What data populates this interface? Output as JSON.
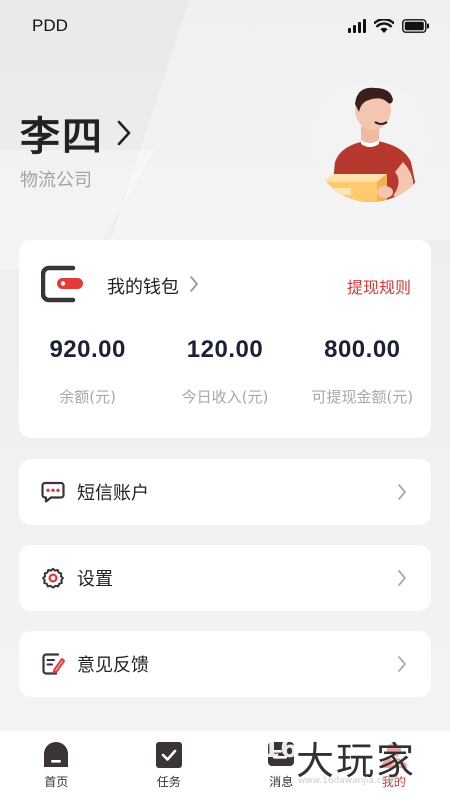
{
  "status_bar": {
    "carrier": "PDD"
  },
  "profile": {
    "name": "李四",
    "company": "物流公司"
  },
  "wallet": {
    "title": "我的钱包",
    "rule_link": "提现规则",
    "stats": [
      {
        "value": "920.00",
        "label": "余额(元)"
      },
      {
        "value": "120.00",
        "label": "今日收入(元)"
      },
      {
        "value": "800.00",
        "label": "可提现金额(元)"
      }
    ]
  },
  "menu": [
    {
      "label": "短信账户",
      "icon": "sms-icon"
    },
    {
      "label": "设置",
      "icon": "gear-icon"
    },
    {
      "label": "意见反馈",
      "icon": "feedback-icon"
    }
  ],
  "tabbar": {
    "items": [
      {
        "label": "首页",
        "icon": "home-icon"
      },
      {
        "label": "任务",
        "icon": "task-icon"
      },
      {
        "label": "消息",
        "icon": "message-icon"
      },
      {
        "label": "我的",
        "icon": "profile-icon",
        "active": true
      }
    ]
  },
  "watermark": {
    "prefix": "16",
    "text": "大玩家",
    "url": "www.16dawanjia.com"
  },
  "colors": {
    "accent": "#d23a3a",
    "dark": "#3b3437",
    "bg": "#f1f1f1"
  }
}
